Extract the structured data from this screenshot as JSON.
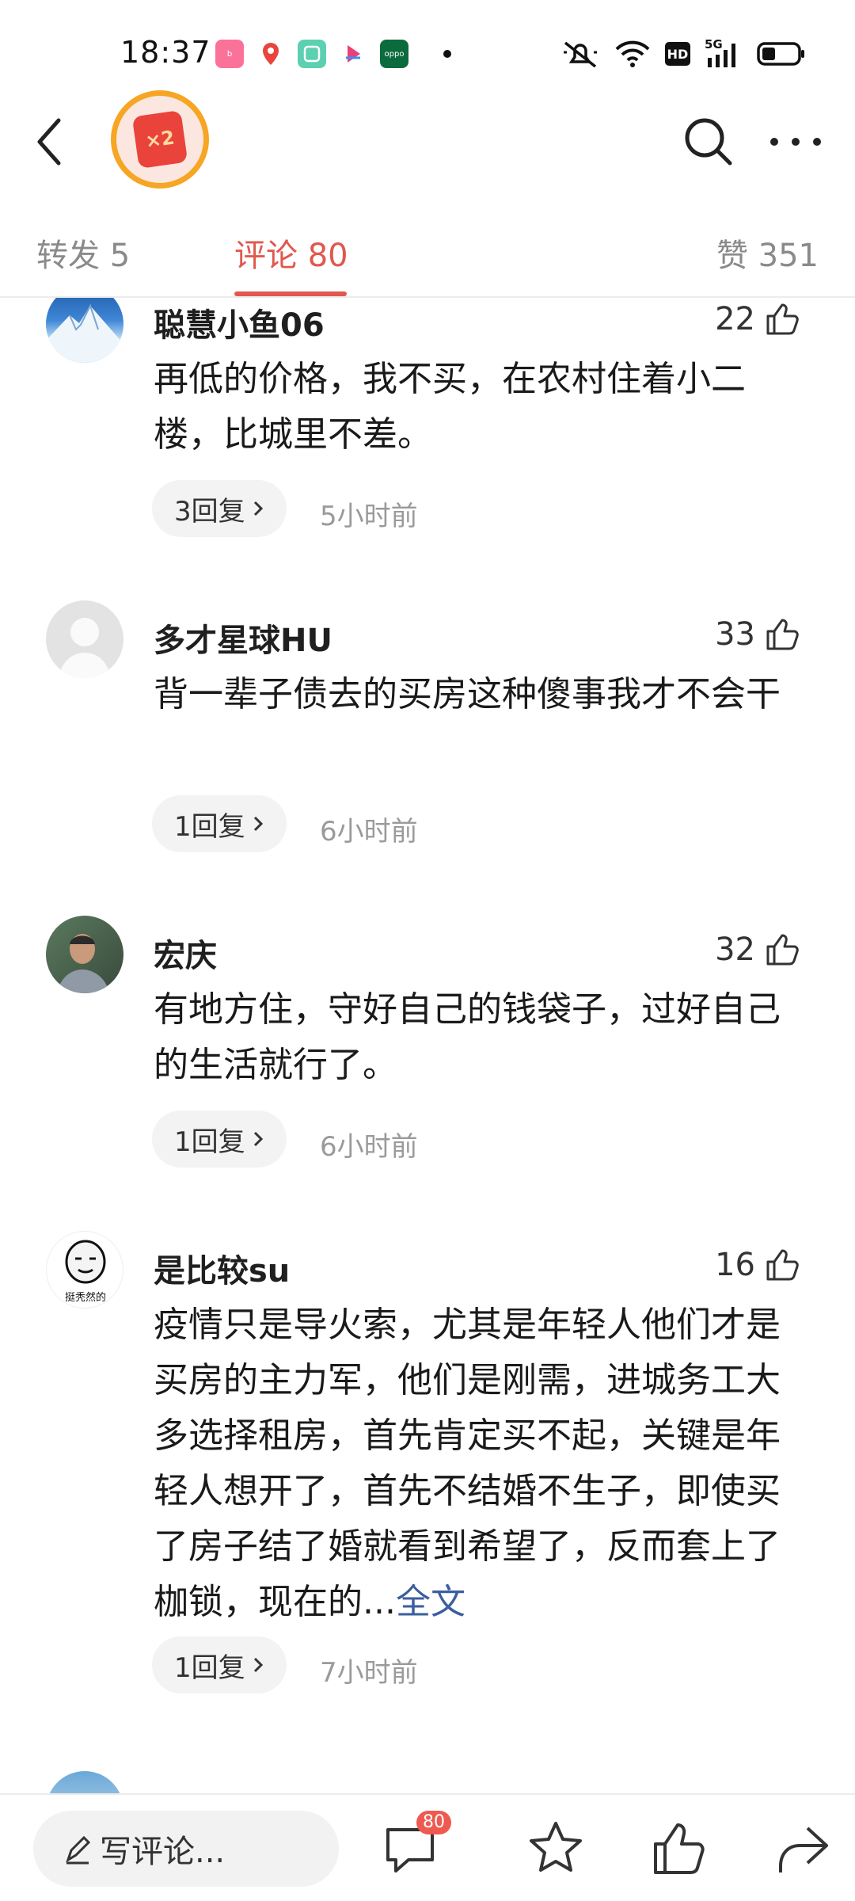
{
  "status_bar": {
    "time": "18:37",
    "app_icons": [
      "bilibili-icon",
      "map-pin-icon",
      "gallery-icon",
      "video-app-icon",
      "oppo-icon"
    ],
    "network": "5G",
    "hd_label": "HD"
  },
  "header": {
    "badge_text": "×2",
    "icons": [
      "back-arrow-icon",
      "search-icon",
      "more-icon"
    ]
  },
  "tabs": [
    {
      "label": "转发 5"
    },
    {
      "label": "评论 80"
    },
    {
      "label": "赞 351"
    }
  ],
  "comments": [
    {
      "name": "聪慧小鱼06",
      "likes": "22",
      "text": "再低的价格，我不买，在农村住着小二楼，比城里不差。",
      "replies": "3回复",
      "time": "5小时前"
    },
    {
      "name": "多才星球HU",
      "likes": "33",
      "text": "背一辈子债去的买房这种傻事我才不会干",
      "replies": "1回复",
      "time": "6小时前"
    },
    {
      "name": "宏庆",
      "likes": "32",
      "text": "有地方住，守好自己的钱袋子，过好自己的生活就行了。",
      "replies": "1回复",
      "time": "6小时前"
    },
    {
      "name": "是比较su",
      "likes": "16",
      "avatar_caption": "挺秃然的",
      "text": "疫情只是导火索，尤其是年轻人他们才是买房的主力军，他们是刚需，进城务工大多选择租房，首先肯定买不起，关键是年轻人想开了，首先不结婚不生子，即使买了房子结了婚就看到希望了，反而套上了枷锁，现在的...",
      "more_label": "全文",
      "replies": "1回复",
      "time": "7小时前"
    }
  ],
  "bottom_bar": {
    "write_placeholder": "写评论...",
    "comment_count": "80",
    "icons": [
      "comment-icon",
      "star-icon",
      "thumbs-up-icon",
      "share-icon"
    ]
  },
  "colors": {
    "accent": "#e0584e",
    "link": "#3b5e9f",
    "muted": "#9a9a9a"
  }
}
